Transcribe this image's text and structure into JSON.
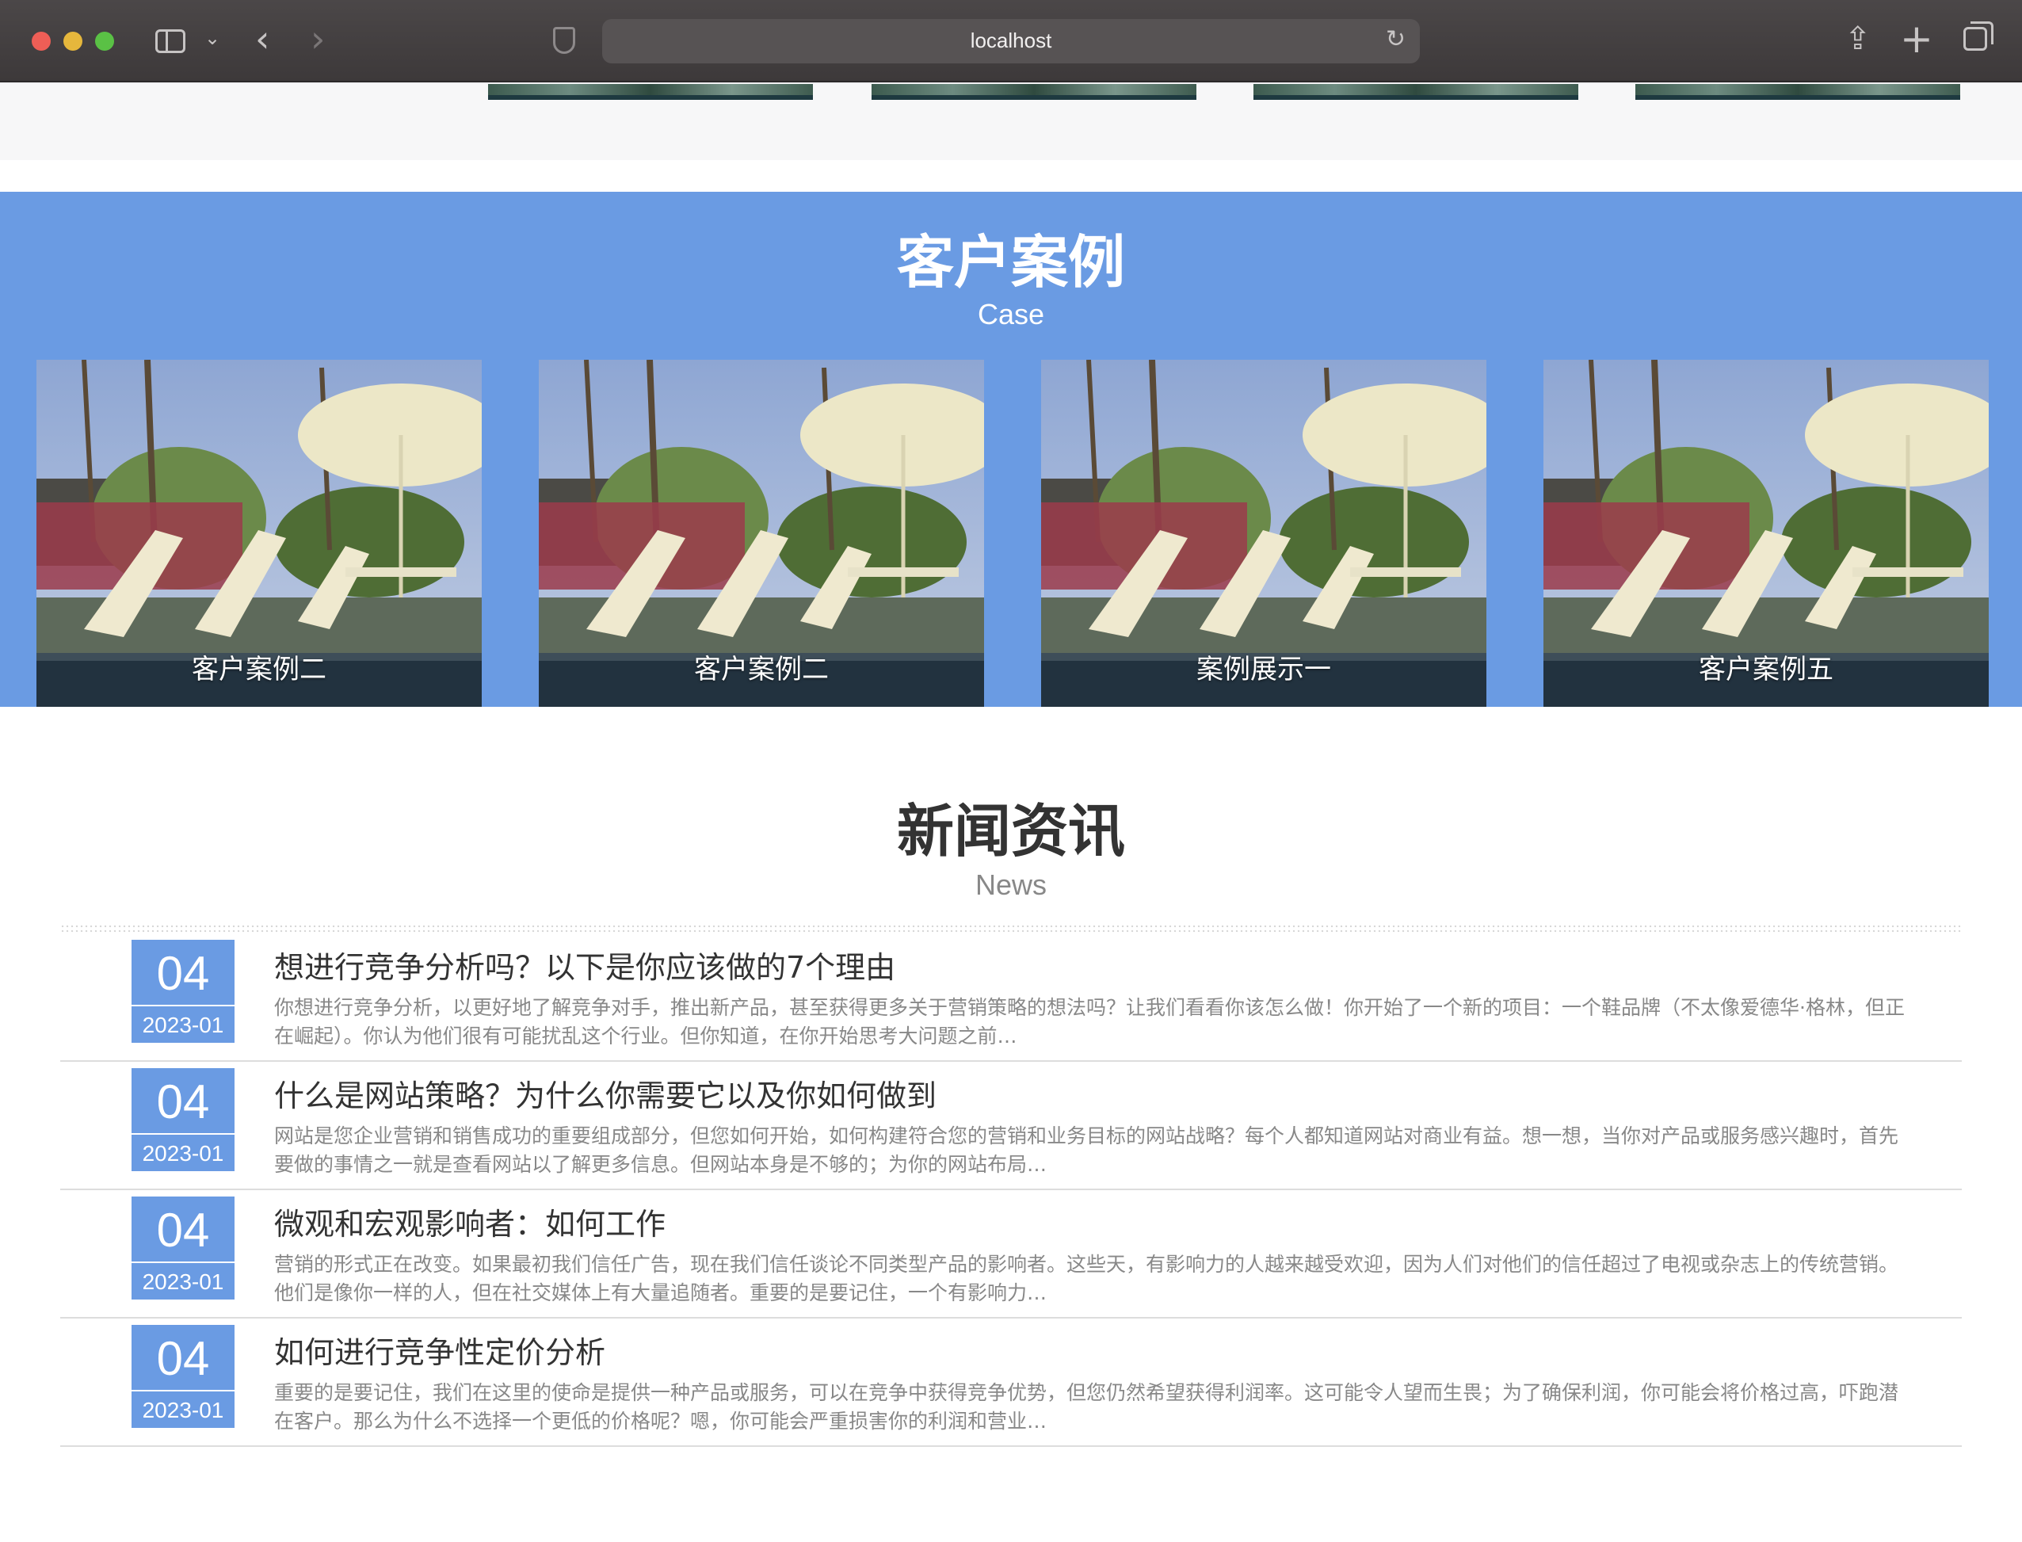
{
  "browser": {
    "url": "localhost"
  },
  "case_section": {
    "title": "客户案例",
    "subtitle": "Case",
    "items": [
      {
        "label": "客户案例二"
      },
      {
        "label": "客户案例二"
      },
      {
        "label": "案例展示一"
      },
      {
        "label": "客户案例五"
      }
    ]
  },
  "news_section": {
    "title": "新闻资讯",
    "subtitle": "News",
    "items": [
      {
        "day": "04",
        "year_month": "2023-01",
        "title": "想进行竞争分析吗？以下是你应该做的7个理由",
        "summary": "你想进行竞争分析，以更好地了解竞争对手，推出新产品，甚至获得更多关于营销策略的想法吗？让我们看看你该怎么做！你开始了一个新的项目：一个鞋品牌（不太像爱德华·格林，但正在崛起）。你认为他们很有可能扰乱这个行业。但你知道，在你开始思考大问题之前…"
      },
      {
        "day": "04",
        "year_month": "2023-01",
        "title": "什么是网站策略？为什么你需要它以及你如何做到",
        "summary": "网站是您企业营销和销售成功的重要组成部分，但您如何开始，如何构建符合您的营销和业务目标的网站战略？每个人都知道网站对商业有益。想一想，当你对产品或服务感兴趣时，首先要做的事情之一就是查看网站以了解更多信息。但网站本身是不够的；为你的网站布局…"
      },
      {
        "day": "04",
        "year_month": "2023-01",
        "title": "微观和宏观影响者：如何工作",
        "summary": "营销的形式正在改变。如果最初我们信任广告，现在我们信任谈论不同类型产品的影响者。这些天，有影响力的人越来越受欢迎，因为人们对他们的信任超过了电视或杂志上的传统营销。他们是像你一样的人，但在社交媒体上有大量追随者。重要的是要记住，一个有影响力…"
      },
      {
        "day": "04",
        "year_month": "2023-01",
        "title": "如何进行竞争性定价分析",
        "summary": "重要的是要记住，我们在这里的使命是提供一种产品或服务，可以在竞争中获得竞争优势，但您仍然希望获得利润率。这可能令人望而生畏；为了确保利润，你可能会将价格过高，吓跑潜在客户。那么为什么不选择一个更低的价格呢？嗯，你可能会严重损害你的利润和营业…"
      }
    ]
  },
  "colors": {
    "accent": "#6a9be3",
    "heading": "#333333",
    "muted": "#888888"
  }
}
